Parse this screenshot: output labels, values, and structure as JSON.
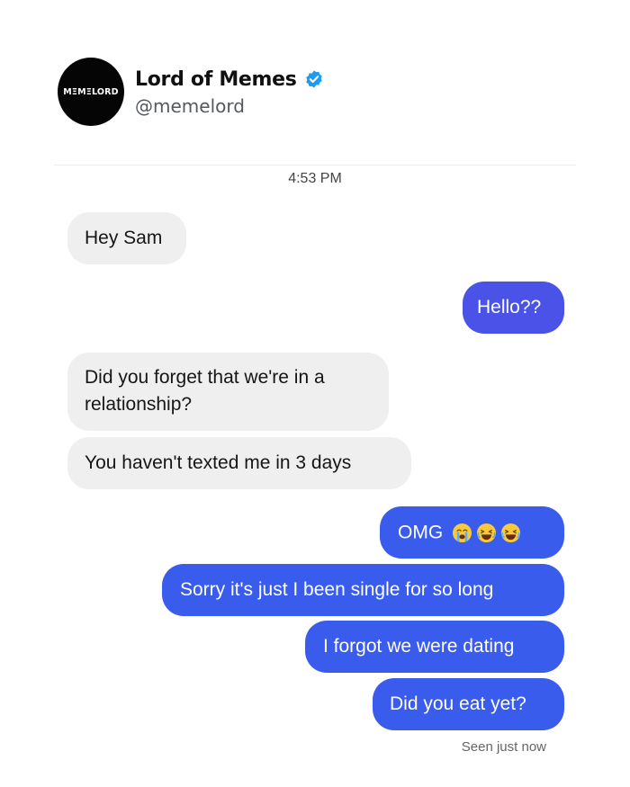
{
  "profile": {
    "avatar_text": "MΞMΞLORD",
    "display_name": "Lord of Memes",
    "handle": "@memelord",
    "verified": true,
    "verified_color": "#1d9bf0"
  },
  "conversation": {
    "timestamp": "4:53 PM",
    "messages": [
      {
        "from": "them",
        "text": "Hey Sam"
      },
      {
        "from": "me",
        "text": "Hello??"
      },
      {
        "from": "them",
        "text": "Did you forget that we're in a relationship?"
      },
      {
        "from": "them",
        "text": "You haven't texted me in 3 days"
      },
      {
        "from": "me",
        "text": "OMG",
        "emojis": [
          "crying-face",
          "laughing-face",
          "laughing-face"
        ]
      },
      {
        "from": "me",
        "text": "Sorry it's just I been single for so long"
      },
      {
        "from": "me",
        "text": "I forgot we were dating"
      },
      {
        "from": "me",
        "text": "Did you eat yet?"
      }
    ],
    "seen_status": "Seen just now"
  },
  "colors": {
    "incoming_bubble": "#efefef",
    "outgoing_bubble": "#3a5ced",
    "outgoing_bubble_alt": "#4b52e8"
  }
}
